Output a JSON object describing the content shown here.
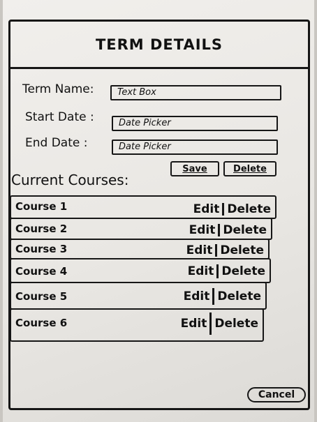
{
  "header": {
    "title": "TERM DETAILS"
  },
  "form": {
    "term_name_label": "Term Name:",
    "term_name_value": "Text Box",
    "start_date_label": "Start Date :",
    "start_date_value": "Date Picker",
    "end_date_label": "End Date :",
    "end_date_value": "Date Picker",
    "save_label": "Save",
    "delete_label": "Delete"
  },
  "courses": {
    "heading": "Current Courses:",
    "items": [
      {
        "name": "Course 1",
        "edit": "Edit",
        "delete": "Delete"
      },
      {
        "name": "Course 2",
        "edit": "Edit",
        "delete": "Delete"
      },
      {
        "name": "Course 3",
        "edit": "Edit",
        "delete": "Delete"
      },
      {
        "name": "Course 4",
        "edit": "Edit",
        "delete": "Delete"
      },
      {
        "name": "Course 5",
        "edit": "Edit",
        "delete": "Delete"
      },
      {
        "name": "Course 6",
        "edit": "Edit",
        "delete": "Delete"
      }
    ]
  },
  "footer": {
    "cancel_label": "Cancel"
  }
}
